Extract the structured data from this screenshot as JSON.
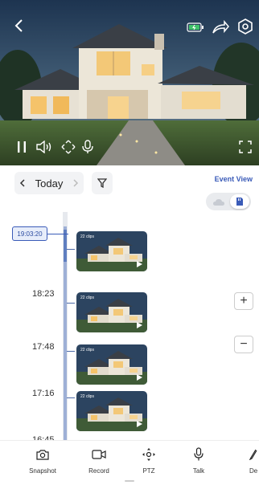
{
  "camera": {
    "back_icon": "chevron-left-icon",
    "battery_icon": "battery-charging-icon",
    "share_icon": "share-arrow-icon",
    "settings_icon": "hexagon-settings-icon",
    "controls": [
      "pause-icon",
      "speaker-icon",
      "ptz-arrows-icon",
      "microphone-icon",
      "fullscreen-icon"
    ]
  },
  "date": {
    "label": "Today",
    "prev_icon": "chevron-left-icon",
    "next_icon": "chevron-right-icon"
  },
  "filter_icon": "filter-icon",
  "event_view_label": "Event View",
  "storage": {
    "cloud_icon": "cloud-icon",
    "sd_icon": "sd-card-icon",
    "selected": "sd"
  },
  "timeline": {
    "current_time": "19:03:20",
    "labels": [
      "18:23",
      "17:48",
      "17:16",
      "16:45"
    ],
    "clips": [
      {
        "count": "22 clips"
      },
      {
        "count": "22 clips"
      },
      {
        "count": "22 clips"
      },
      {
        "count": "22 clips"
      }
    ]
  },
  "zoom": {
    "in": "+",
    "out": "−"
  },
  "actions": [
    {
      "label": "Snapshot",
      "icon": "camera-icon"
    },
    {
      "label": "Record",
      "icon": "video-record-icon"
    },
    {
      "label": "PTZ",
      "icon": "ptz-icon"
    },
    {
      "label": "Talk",
      "icon": "microphone-icon"
    },
    {
      "label": "De",
      "icon": "pen-icon"
    }
  ],
  "colors": {
    "accent": "#3a5bb8",
    "timeline_fill": "#9eb0d6"
  }
}
